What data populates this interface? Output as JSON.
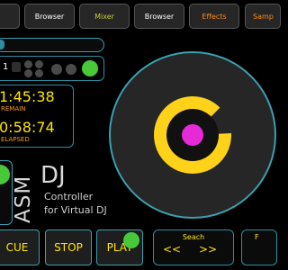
{
  "tabs": [
    {
      "label": "",
      "color": "#ffffff"
    },
    {
      "label": "Browser",
      "color": "#ffffff"
    },
    {
      "label": "Mixer",
      "color": "#c9c93a"
    },
    {
      "label": "Browser",
      "color": "#ffffff"
    },
    {
      "label": "Effects",
      "color": "#ff8a1a"
    },
    {
      "label": "Samp",
      "color": "#ff8a1a"
    }
  ],
  "deck": {
    "number": "1",
    "remain_time": "1:45:38",
    "remain_label": "REMAIN",
    "elapsed_time": "0:58:74",
    "elapsed_label": "ELAPSED"
  },
  "brand": {
    "vertical": "ASM",
    "title": "DJ",
    "subtitle1": "Controller",
    "subtitle2": "for Virtual DJ"
  },
  "transport": {
    "cue": "CUE",
    "stop": "STOP",
    "play": "PLAY"
  },
  "search": {
    "label": "Seach",
    "back": "<<",
    "forward": ">>",
    "cut_label": "F"
  },
  "colors": {
    "accent_border": "#2a8fa0",
    "text_yellow": "#ffe600",
    "green": "#47c93a",
    "platter_ring": "#ffd21a",
    "platter_center": "#e52ad6",
    "time_label": "#ff9a1a"
  }
}
